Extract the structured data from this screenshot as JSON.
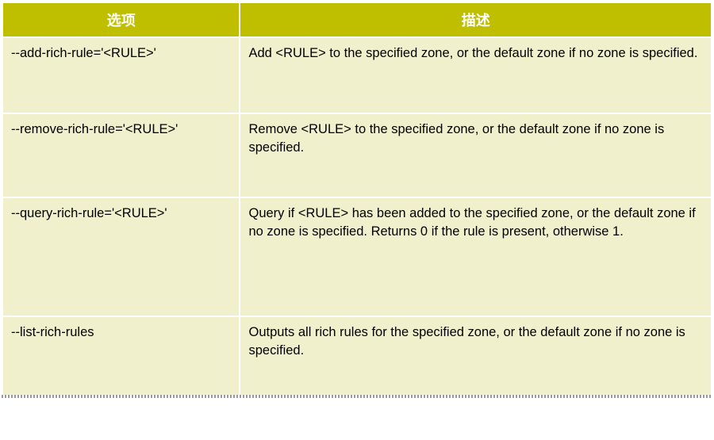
{
  "headers": {
    "option": "选项",
    "description": "描述"
  },
  "rows": [
    {
      "option": "--add-rich-rule='<RULE>'",
      "description": "Add <RULE> to the specified zone, or the default zone if no zone is specified."
    },
    {
      "option": "--remove-rich-rule='<RULE>'",
      "description": "Remove <RULE> to the specified zone, or the default zone if no zone is specified."
    },
    {
      "option": "--query-rich-rule='<RULE>'",
      "description": "Query if <RULE> has been added to the specified zone, or the default zone if no zone is specified. Returns 0 if the rule is present, otherwise 1."
    },
    {
      "option": "--list-rich-rules",
      "description": "Outputs all rich rules for the specified zone, or the default zone if no zone is specified."
    }
  ]
}
